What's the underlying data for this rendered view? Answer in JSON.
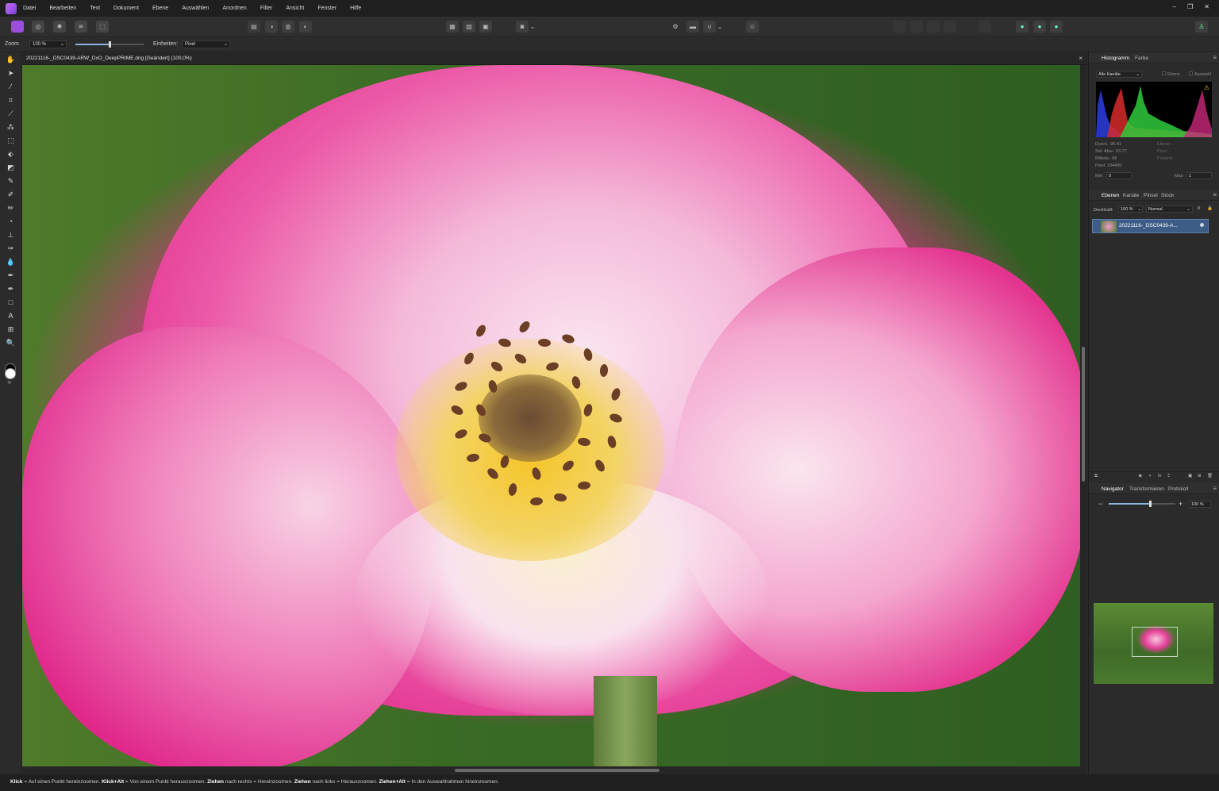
{
  "menu": {
    "items": [
      "Datei",
      "Bearbeiten",
      "Text",
      "Dokument",
      "Ebene",
      "Auswählen",
      "Anordnen",
      "Filter",
      "Ansicht",
      "Fenster",
      "Hilfe"
    ]
  },
  "context": {
    "zoom_label": "Zoom",
    "zoom_value": "100 %",
    "zoom_slider_fraction": 0.5,
    "units_label": "Einheiten:",
    "units_value": "Pixel"
  },
  "document": {
    "title": "20221116-_DSC0439-ARW_DxO_DeepPRIME.dng [Geändert] (100,0%)",
    "close": "×"
  },
  "histogram": {
    "tabs": [
      "Histogramm",
      "Farbe"
    ],
    "channel": "Alle Kanäle",
    "opt_layer": "Ebene",
    "opt_selection": "Auswahl",
    "stats_left": [
      "Durch.: 95.41",
      "Std. Abw.: 53.77",
      "Mittelw.: 86",
      "Pixel: 194400"
    ],
    "stats_right": [
      "Ebene: -",
      "Pixel: -",
      "Prozent: -"
    ],
    "min_label": "Min:",
    "min_value": "0",
    "max_label": "Max:",
    "max_value": "1",
    "warning_icon": "warning-icon"
  },
  "layers": {
    "tabs": [
      "Ebenen",
      "Kanäle",
      "Pinsel",
      "Stock"
    ],
    "opacity_label": "Deckkraft:",
    "opacity_value": "100 %",
    "blend_mode": "Normal",
    "layer_name": "20221116-_DSC0439-A..."
  },
  "navigator": {
    "tabs": [
      "Navigator",
      "Transformieren",
      "Protokoll"
    ],
    "zoom_value": "100 %",
    "minus": "−",
    "plus": "+"
  },
  "status": {
    "k1": "Klick",
    "t1": " = Auf einen Punkt hereinzoomen. ",
    "k2": "Klick+Alt",
    "t2": " = Von einem Punkt herauszoomen. ",
    "k3": "Ziehen",
    "t3": " nach rechts = Hereinzoomen. ",
    "k4": "Ziehen",
    "t4": " nach links = Herauszoomen. ",
    "k5": "Ziehen+Alt",
    "t5": " = In den Auswahlrahmen hineinzoomen."
  },
  "colors": {
    "accent": "#3d5d86",
    "app_logo": "#a34fe3",
    "canvas_bg": "#2b2b2b"
  }
}
